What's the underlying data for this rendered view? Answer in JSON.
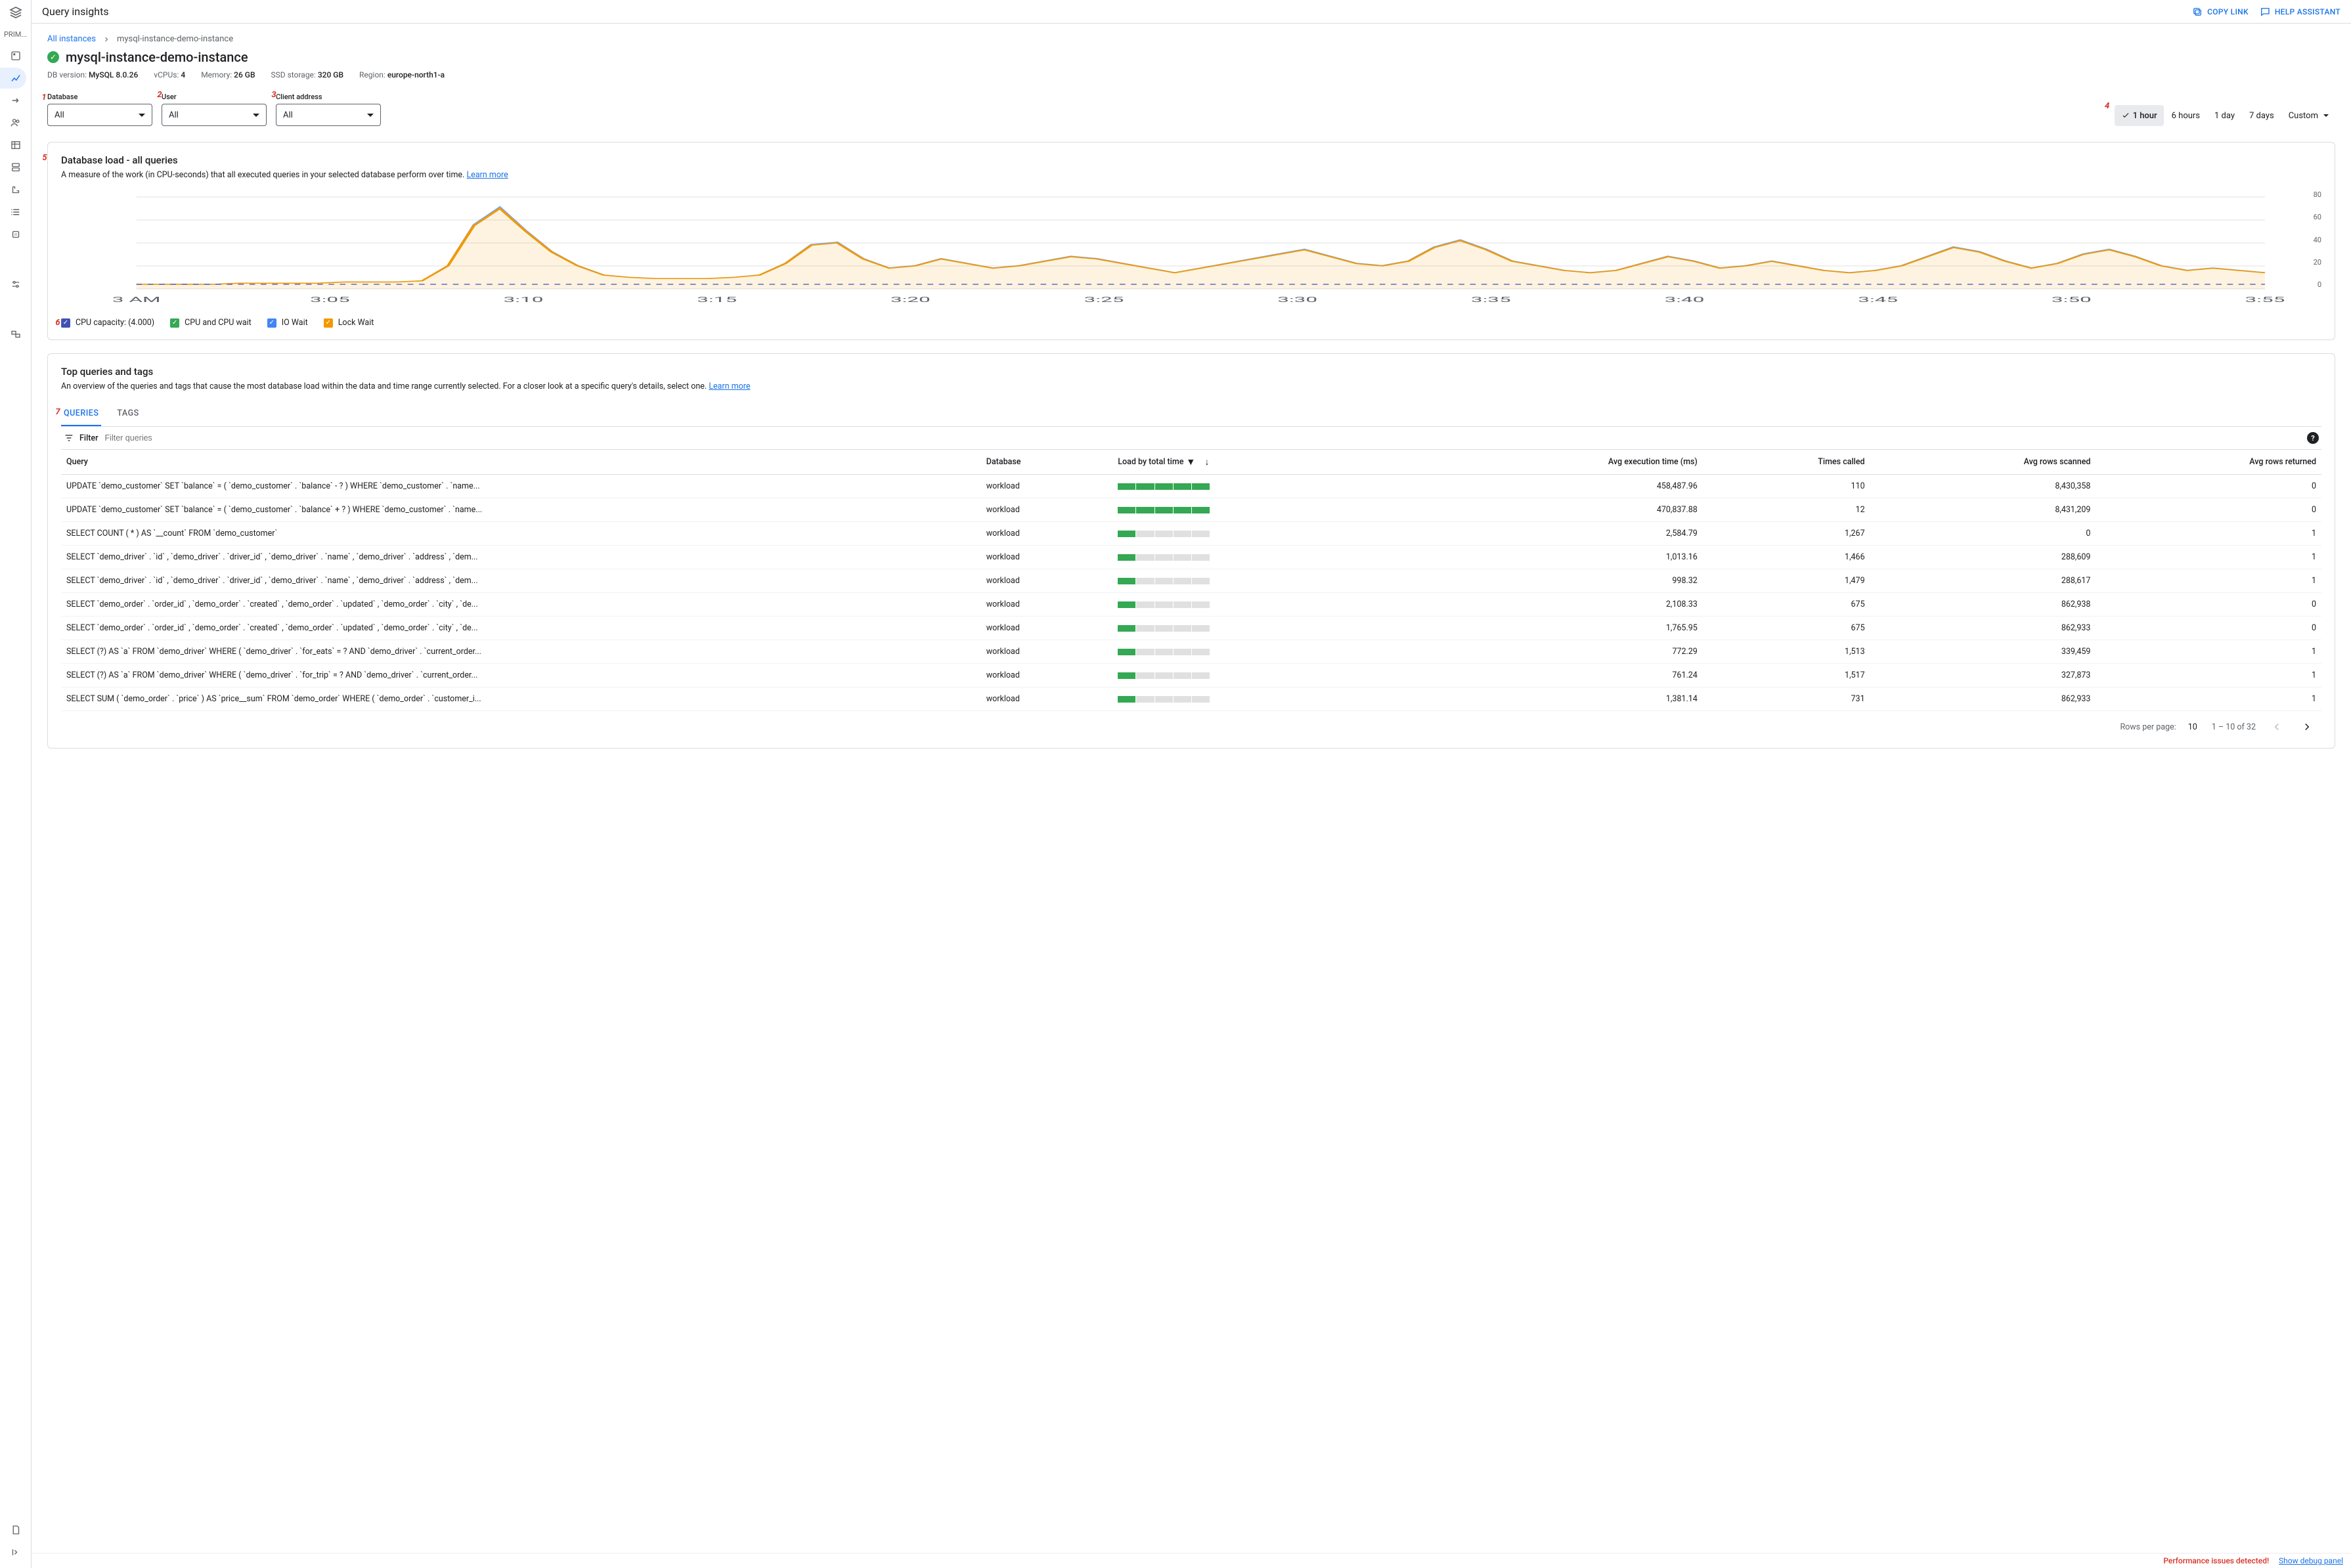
{
  "topbar": {
    "title": "Query insights",
    "copy_link": "COPY LINK",
    "help_assistant": "HELP ASSISTANT"
  },
  "rail": {
    "section": "PRIM..."
  },
  "crumbs": {
    "root": "All instances",
    "instance": "mysql-instance-demo-instance"
  },
  "instance": {
    "name": "mysql-instance-demo-instance"
  },
  "meta": {
    "db_version_label": "DB version:",
    "db_version": "MySQL 8.0.26",
    "vcpu_label": "vCPUs:",
    "vcpu": "4",
    "mem_label": "Memory:",
    "mem": "26 GB",
    "ssd_label": "SSD storage:",
    "ssd": "320 GB",
    "region_label": "Region:",
    "region": "europe-north1-a"
  },
  "filters": {
    "database_label": "Database",
    "database_value": "All",
    "user_label": "User",
    "user_value": "All",
    "client_label": "Client address",
    "client_value": "All"
  },
  "timerange": {
    "options": [
      "1 hour",
      "6 hours",
      "1 day",
      "7 days",
      "Custom"
    ],
    "active": "1 hour"
  },
  "step_badges": [
    "1",
    "2",
    "3",
    "4",
    "5",
    "6",
    "7"
  ],
  "load_card": {
    "title": "Database load - all queries",
    "sub": "A measure of the work (in CPU-seconds) that all executed queries in your selected database perform over time.",
    "learn_more": "Learn more",
    "legend": {
      "cap": "CPU capacity: (4.000)",
      "cpu": "CPU and CPU wait",
      "io": "IO Wait",
      "lock": "Lock Wait"
    }
  },
  "chart_data": {
    "type": "area",
    "title": "Database load - all queries",
    "xlabel": "",
    "ylabel": "",
    "ylim": [
      0,
      80
    ],
    "y_ticks": [
      0,
      20,
      40,
      60,
      80
    ],
    "x_ticks": [
      "3 AM",
      "3:05",
      "3:10",
      "3:15",
      "3:20",
      "3:25",
      "3:30",
      "3:35",
      "3:40",
      "3:45",
      "3:50",
      "3:55"
    ],
    "capacity_line": 4.0,
    "series": [
      {
        "name": "CPU and CPU wait",
        "color": "#34a853"
      },
      {
        "name": "IO Wait",
        "color": "#4285f4"
      },
      {
        "name": "Lock Wait",
        "color": "#f29900",
        "values": [
          4,
          4,
          4,
          4,
          5,
          5,
          5,
          5,
          6,
          6,
          6,
          7,
          20,
          55,
          70,
          50,
          32,
          20,
          12,
          10,
          9,
          9,
          9,
          10,
          12,
          22,
          38,
          40,
          26,
          18,
          20,
          26,
          22,
          18,
          20,
          24,
          28,
          26,
          22,
          18,
          14,
          18,
          22,
          26,
          30,
          34,
          28,
          22,
          20,
          24,
          36,
          42,
          34,
          24,
          20,
          16,
          14,
          16,
          22,
          28,
          24,
          18,
          20,
          24,
          20,
          16,
          14,
          16,
          20,
          28,
          36,
          32,
          24,
          18,
          22,
          30,
          34,
          28,
          20,
          16,
          18,
          16,
          14
        ]
      }
    ]
  },
  "top_card": {
    "title": "Top queries and tags",
    "sub": "An overview of the queries and tags that cause the most database load within the data and time range currently selected. For a closer look at a specific query's details, select one.",
    "learn_more": "Learn more"
  },
  "tabs": {
    "queries": "QUERIES",
    "tags": "TAGS"
  },
  "filterbar": {
    "label": "Filter",
    "placeholder": "Filter queries"
  },
  "table": {
    "headers": {
      "query": "Query",
      "database": "Database",
      "load": "Load by total time",
      "exec": "Avg execution time (ms)",
      "times": "Times called",
      "scanned": "Avg rows scanned",
      "returned": "Avg rows returned"
    },
    "rows": [
      {
        "query": "UPDATE `demo_customer` SET `balance` = ( `demo_customer` . `balance` - ? ) WHERE `demo_customer` . `name...",
        "database": "workload",
        "load": 5,
        "exec": "458,487.96",
        "times": "110",
        "scanned": "8,430,358",
        "returned": "0"
      },
      {
        "query": "UPDATE `demo_customer` SET `balance` = ( `demo_customer` . `balance` + ? ) WHERE `demo_customer` . `name...",
        "database": "workload",
        "load": 5,
        "exec": "470,837.88",
        "times": "12",
        "scanned": "8,431,209",
        "returned": "0"
      },
      {
        "query": "SELECT COUNT ( * ) AS `__count` FROM `demo_customer`",
        "database": "workload",
        "load": 1,
        "exec": "2,584.79",
        "times": "1,267",
        "scanned": "0",
        "returned": "1"
      },
      {
        "query": "SELECT `demo_driver` . `id` , `demo_driver` . `driver_id` , `demo_driver` . `name` , `demo_driver` . `address` , `dem...",
        "database": "workload",
        "load": 1,
        "exec": "1,013.16",
        "times": "1,466",
        "scanned": "288,609",
        "returned": "1"
      },
      {
        "query": "SELECT `demo_driver` . `id` , `demo_driver` . `driver_id` , `demo_driver` . `name` , `demo_driver` . `address` , `dem...",
        "database": "workload",
        "load": 1,
        "exec": "998.32",
        "times": "1,479",
        "scanned": "288,617",
        "returned": "1"
      },
      {
        "query": "SELECT `demo_order` . `order_id` , `demo_order` . `created` , `demo_order` . `updated` , `demo_order` . `city` , `de...",
        "database": "workload",
        "load": 1,
        "exec": "2,108.33",
        "times": "675",
        "scanned": "862,938",
        "returned": "0"
      },
      {
        "query": "SELECT `demo_order` . `order_id` , `demo_order` . `created` , `demo_order` . `updated` , `demo_order` . `city` , `de...",
        "database": "workload",
        "load": 1,
        "exec": "1,765.95",
        "times": "675",
        "scanned": "862,933",
        "returned": "0"
      },
      {
        "query": "SELECT (?) AS `a` FROM `demo_driver` WHERE ( `demo_driver` . `for_eats` = ? AND `demo_driver` . `current_order...",
        "database": "workload",
        "load": 1,
        "exec": "772.29",
        "times": "1,513",
        "scanned": "339,459",
        "returned": "1"
      },
      {
        "query": "SELECT (?) AS `a` FROM `demo_driver` WHERE ( `demo_driver` . `for_trip` = ? AND `demo_driver` . `current_order...",
        "database": "workload",
        "load": 1,
        "exec": "761.24",
        "times": "1,517",
        "scanned": "327,873",
        "returned": "1"
      },
      {
        "query": "SELECT SUM ( `demo_order` . `price` ) AS `price__sum` FROM `demo_order` WHERE ( `demo_order` . `customer_i...",
        "database": "workload",
        "load": 1,
        "exec": "1,381.14",
        "times": "731",
        "scanned": "862,933",
        "returned": "1"
      }
    ]
  },
  "pagination": {
    "rows_label": "Rows per page:",
    "rows_per_page": "10",
    "range": "1 – 10 of 32"
  },
  "footer": {
    "warn": "Performance issues detected!",
    "debug": "Show debug panel"
  }
}
